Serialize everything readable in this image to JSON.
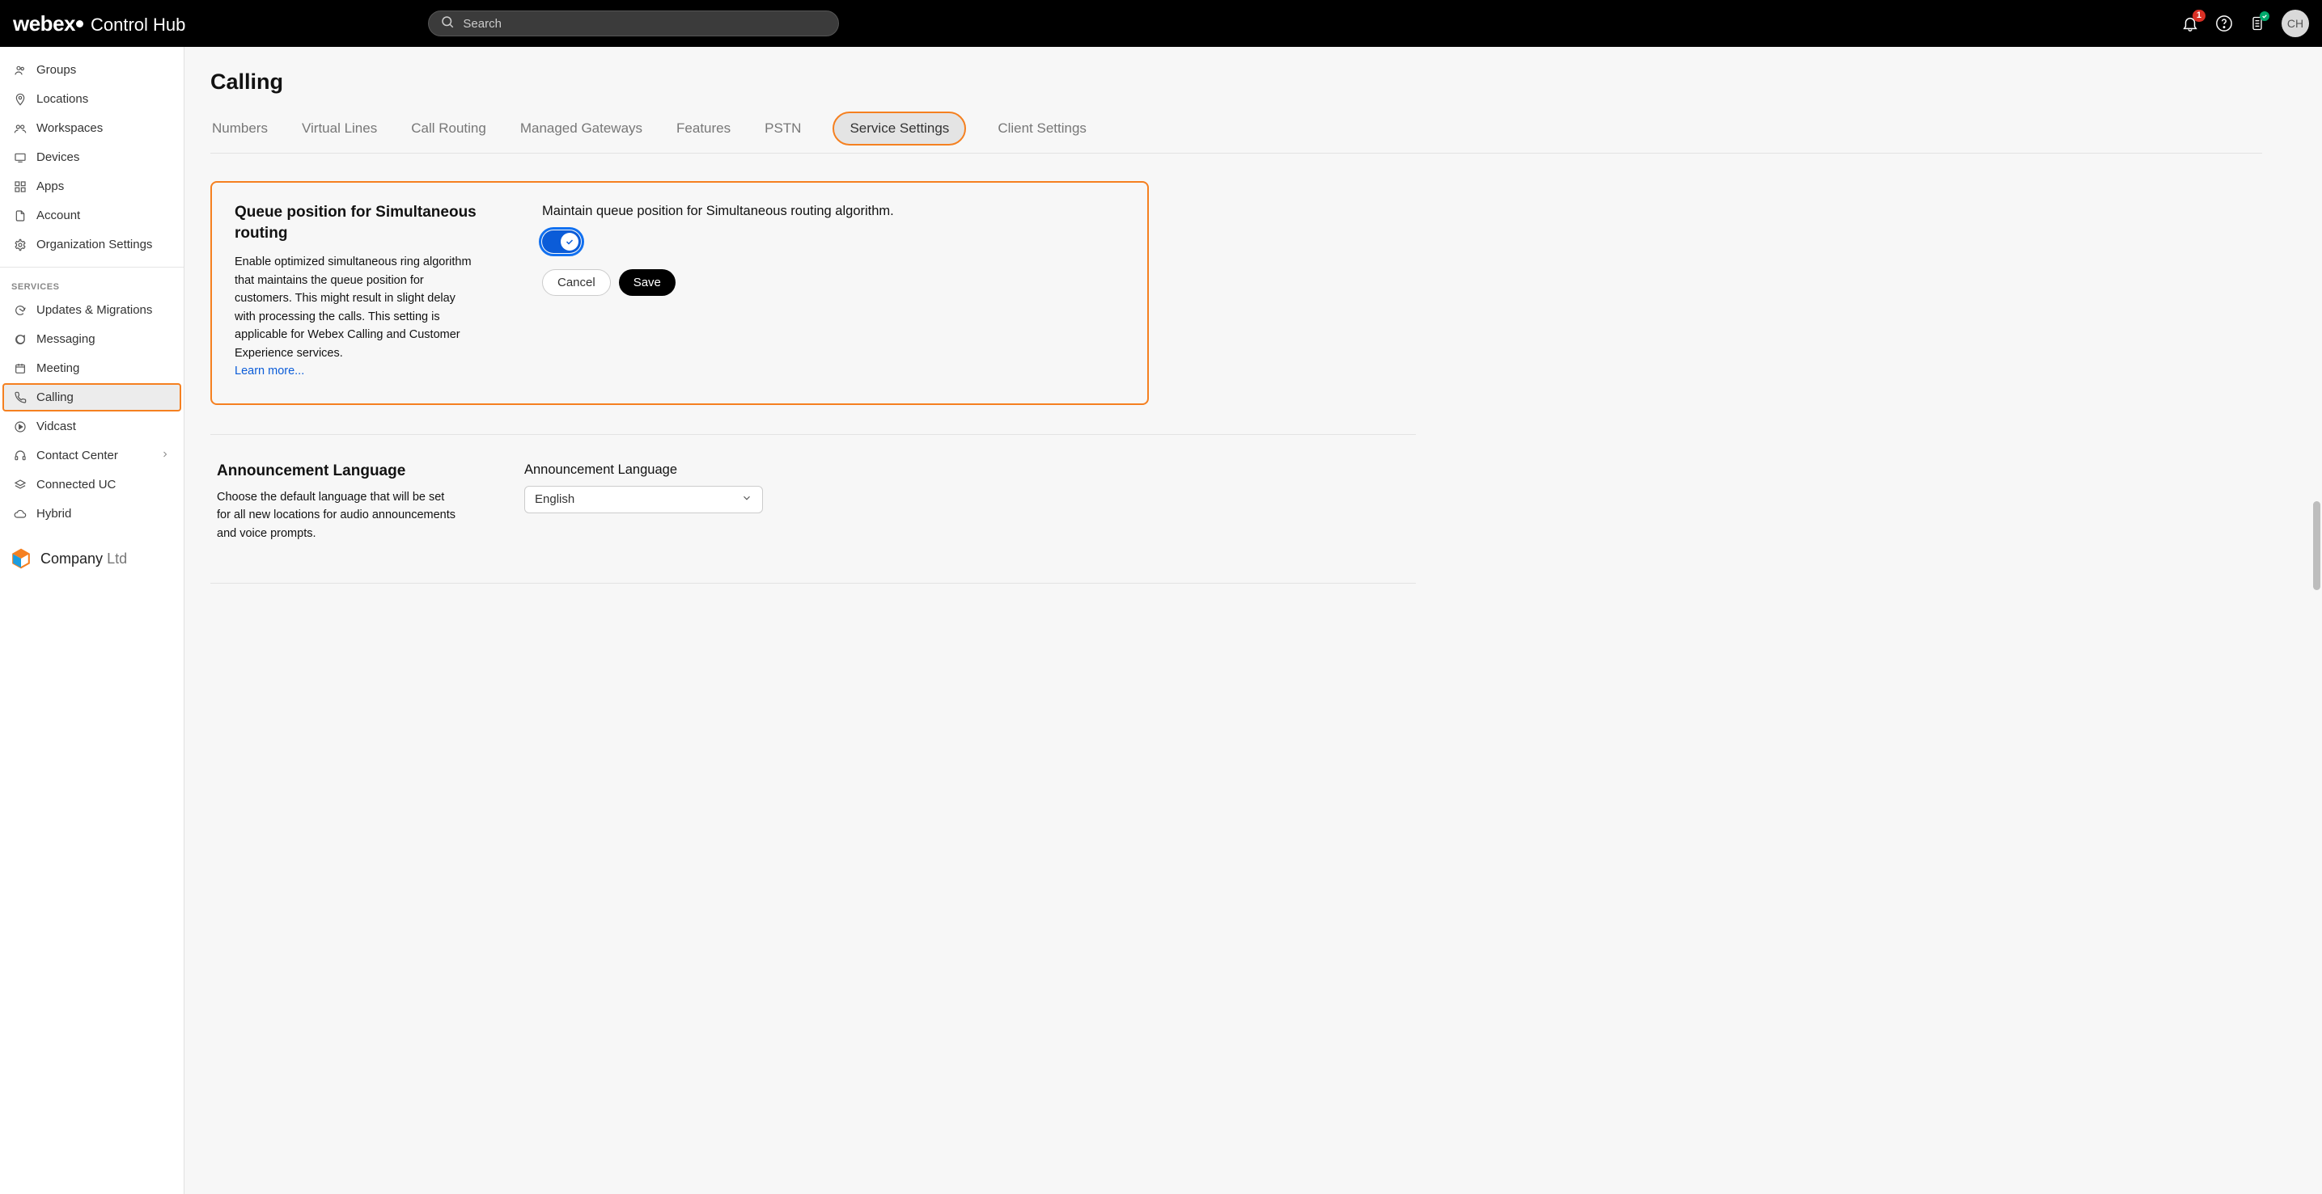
{
  "header": {
    "brand": "webex",
    "product": "Control Hub",
    "search_placeholder": "Search",
    "notification_count": "1",
    "avatar_initials": "CH"
  },
  "sidebar": {
    "top_items": [
      {
        "id": "groups",
        "label": "Groups",
        "icon": "users"
      },
      {
        "id": "locations",
        "label": "Locations",
        "icon": "pin"
      },
      {
        "id": "workspaces",
        "label": "Workspaces",
        "icon": "users"
      },
      {
        "id": "devices",
        "label": "Devices",
        "icon": "device"
      },
      {
        "id": "apps",
        "label": "Apps",
        "icon": "grid"
      },
      {
        "id": "account",
        "label": "Account",
        "icon": "file"
      },
      {
        "id": "org",
        "label": "Organization Settings",
        "icon": "gear"
      }
    ],
    "services_label": "SERVICES",
    "service_items": [
      {
        "id": "updates",
        "label": "Updates & Migrations",
        "icon": "refresh"
      },
      {
        "id": "messaging",
        "label": "Messaging",
        "icon": "chat"
      },
      {
        "id": "meeting",
        "label": "Meeting",
        "icon": "calendar"
      },
      {
        "id": "calling",
        "label": "Calling",
        "icon": "phone",
        "active": true
      },
      {
        "id": "vidcast",
        "label": "Vidcast",
        "icon": "play"
      },
      {
        "id": "contact",
        "label": "Contact Center",
        "icon": "headset",
        "chevron": true
      },
      {
        "id": "cuc",
        "label": "Connected UC",
        "icon": "stack"
      },
      {
        "id": "hybrid",
        "label": "Hybrid",
        "icon": "cloud"
      }
    ],
    "company_name": "Company",
    "company_suffix": "Ltd"
  },
  "main": {
    "title": "Calling",
    "tabs": [
      {
        "id": "numbers",
        "label": "Numbers"
      },
      {
        "id": "vlines",
        "label": "Virtual Lines"
      },
      {
        "id": "routing",
        "label": "Call Routing"
      },
      {
        "id": "gateways",
        "label": "Managed Gateways"
      },
      {
        "id": "features",
        "label": "Features"
      },
      {
        "id": "pstn",
        "label": "PSTN"
      },
      {
        "id": "service",
        "label": "Service Settings",
        "active": true
      },
      {
        "id": "client",
        "label": "Client Settings"
      }
    ],
    "queue_card": {
      "title": "Queue position for Simultaneous routing",
      "description": "Enable optimized simultaneous ring algorithm that maintains the queue position for customers. This might result in slight delay with processing the calls. This setting is applicable for Webex Calling and Customer Experience services.",
      "learn_more": "Learn more...",
      "field_label": "Maintain queue position for Simultaneous routing algorithm.",
      "toggle_on": true,
      "cancel": "Cancel",
      "save": "Save"
    },
    "announcement": {
      "title": "Announcement Language",
      "description": "Choose the default language that will be set for all new locations for audio announcements and voice prompts.",
      "field_label": "Announcement Language",
      "selected": "English"
    }
  }
}
